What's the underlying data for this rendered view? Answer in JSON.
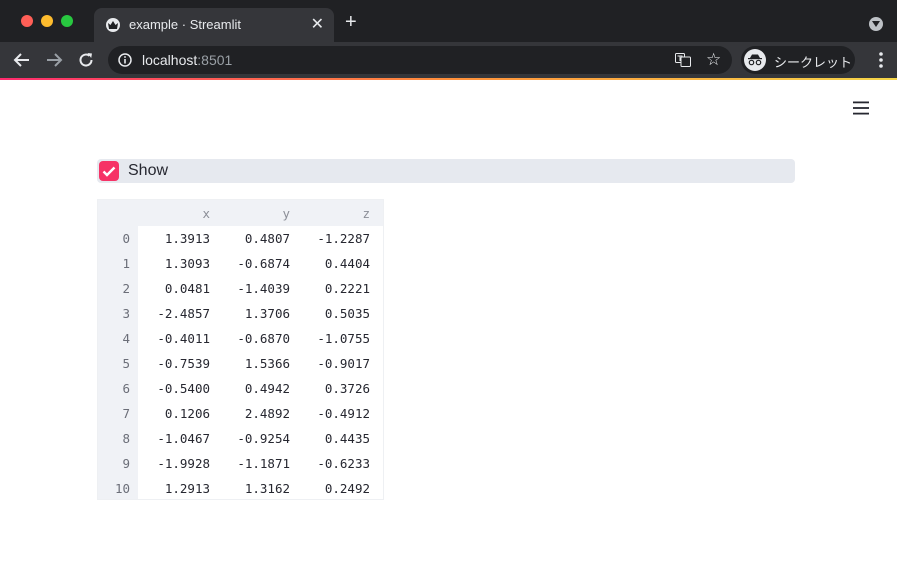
{
  "browser": {
    "tab_title": "example · Streamlit",
    "tab_close": "✕",
    "new_tab": "+",
    "url_host": "localhost",
    "url_port": ":8501",
    "star": "☆",
    "incognito_label": "シークレット"
  },
  "app": {
    "checkbox": {
      "label": "Show",
      "checked": true,
      "color": "#f63366"
    },
    "table": {
      "columns": [
        "x",
        "y",
        "z"
      ],
      "rows": [
        {
          "index": "0",
          "values": [
            "1.3913",
            "0.4807",
            "-1.2287"
          ]
        },
        {
          "index": "1",
          "values": [
            "1.3093",
            "-0.6874",
            "0.4404"
          ]
        },
        {
          "index": "2",
          "values": [
            "0.0481",
            "-1.4039",
            "0.2221"
          ]
        },
        {
          "index": "3",
          "values": [
            "-2.4857",
            "1.3706",
            "0.5035"
          ]
        },
        {
          "index": "4",
          "values": [
            "-0.4011",
            "-0.6870",
            "-1.0755"
          ]
        },
        {
          "index": "5",
          "values": [
            "-0.7539",
            "1.5366",
            "-0.9017"
          ]
        },
        {
          "index": "6",
          "values": [
            "-0.5400",
            "0.4942",
            "0.3726"
          ]
        },
        {
          "index": "7",
          "values": [
            "0.1206",
            "2.4892",
            "-0.4912"
          ]
        },
        {
          "index": "8",
          "values": [
            "-1.0467",
            "-0.9254",
            "0.4435"
          ]
        },
        {
          "index": "9",
          "values": [
            "-1.9928",
            "-1.1871",
            "-0.6233"
          ]
        },
        {
          "index": "10",
          "values": [
            "1.2913",
            "1.3162",
            "0.2492"
          ]
        }
      ]
    }
  }
}
